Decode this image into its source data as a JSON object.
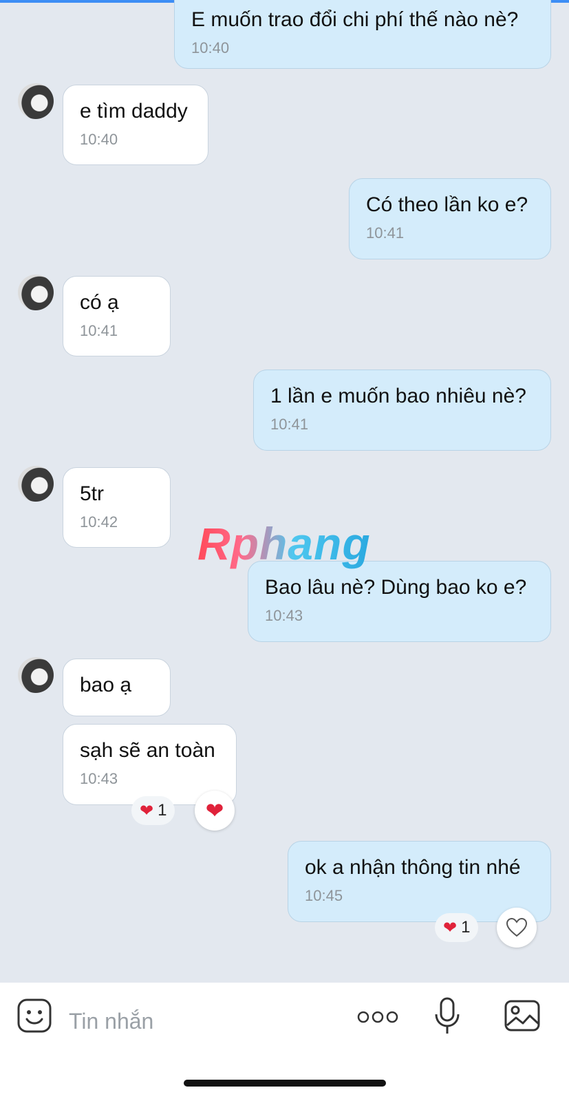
{
  "messages": [
    {
      "side": "out",
      "text": "E muốn trao đổi chi phí thế nào nè?",
      "time": "10:40"
    },
    {
      "side": "in",
      "text": "e tìm daddy",
      "time": "10:40"
    },
    {
      "side": "out",
      "text": "Có theo lần ko e?",
      "time": "10:41"
    },
    {
      "side": "in",
      "text": "có ạ",
      "time": "10:41"
    },
    {
      "side": "out",
      "text": "1 lần e muốn bao nhiêu nè?",
      "time": "10:41"
    },
    {
      "side": "in",
      "text": "5tr",
      "time": "10:42"
    },
    {
      "side": "out",
      "text": "Bao lâu nè? Dùng bao ko e?",
      "time": "10:43"
    },
    {
      "side": "in",
      "text": "bao ạ",
      "time": ""
    },
    {
      "side": "in",
      "text": "sạh sẽ an toàn",
      "time": "10:43"
    },
    {
      "side": "out",
      "text": "ok a nhận thông tin nhé",
      "time": "10:45"
    }
  ],
  "reactions": {
    "msg9": {
      "count": "1"
    },
    "msg10": {
      "count": "1"
    }
  },
  "watermark": "Rphang",
  "composer": {
    "placeholder": "Tin nhắn",
    "icons": [
      "sticker-icon",
      "more-icon",
      "microphone-icon",
      "image-icon"
    ]
  },
  "colors": {
    "background": "#e3e8ef",
    "incoming_bubble": "#ffffff",
    "outgoing_bubble": "#d4ecfb",
    "heart": "#e0223a"
  }
}
